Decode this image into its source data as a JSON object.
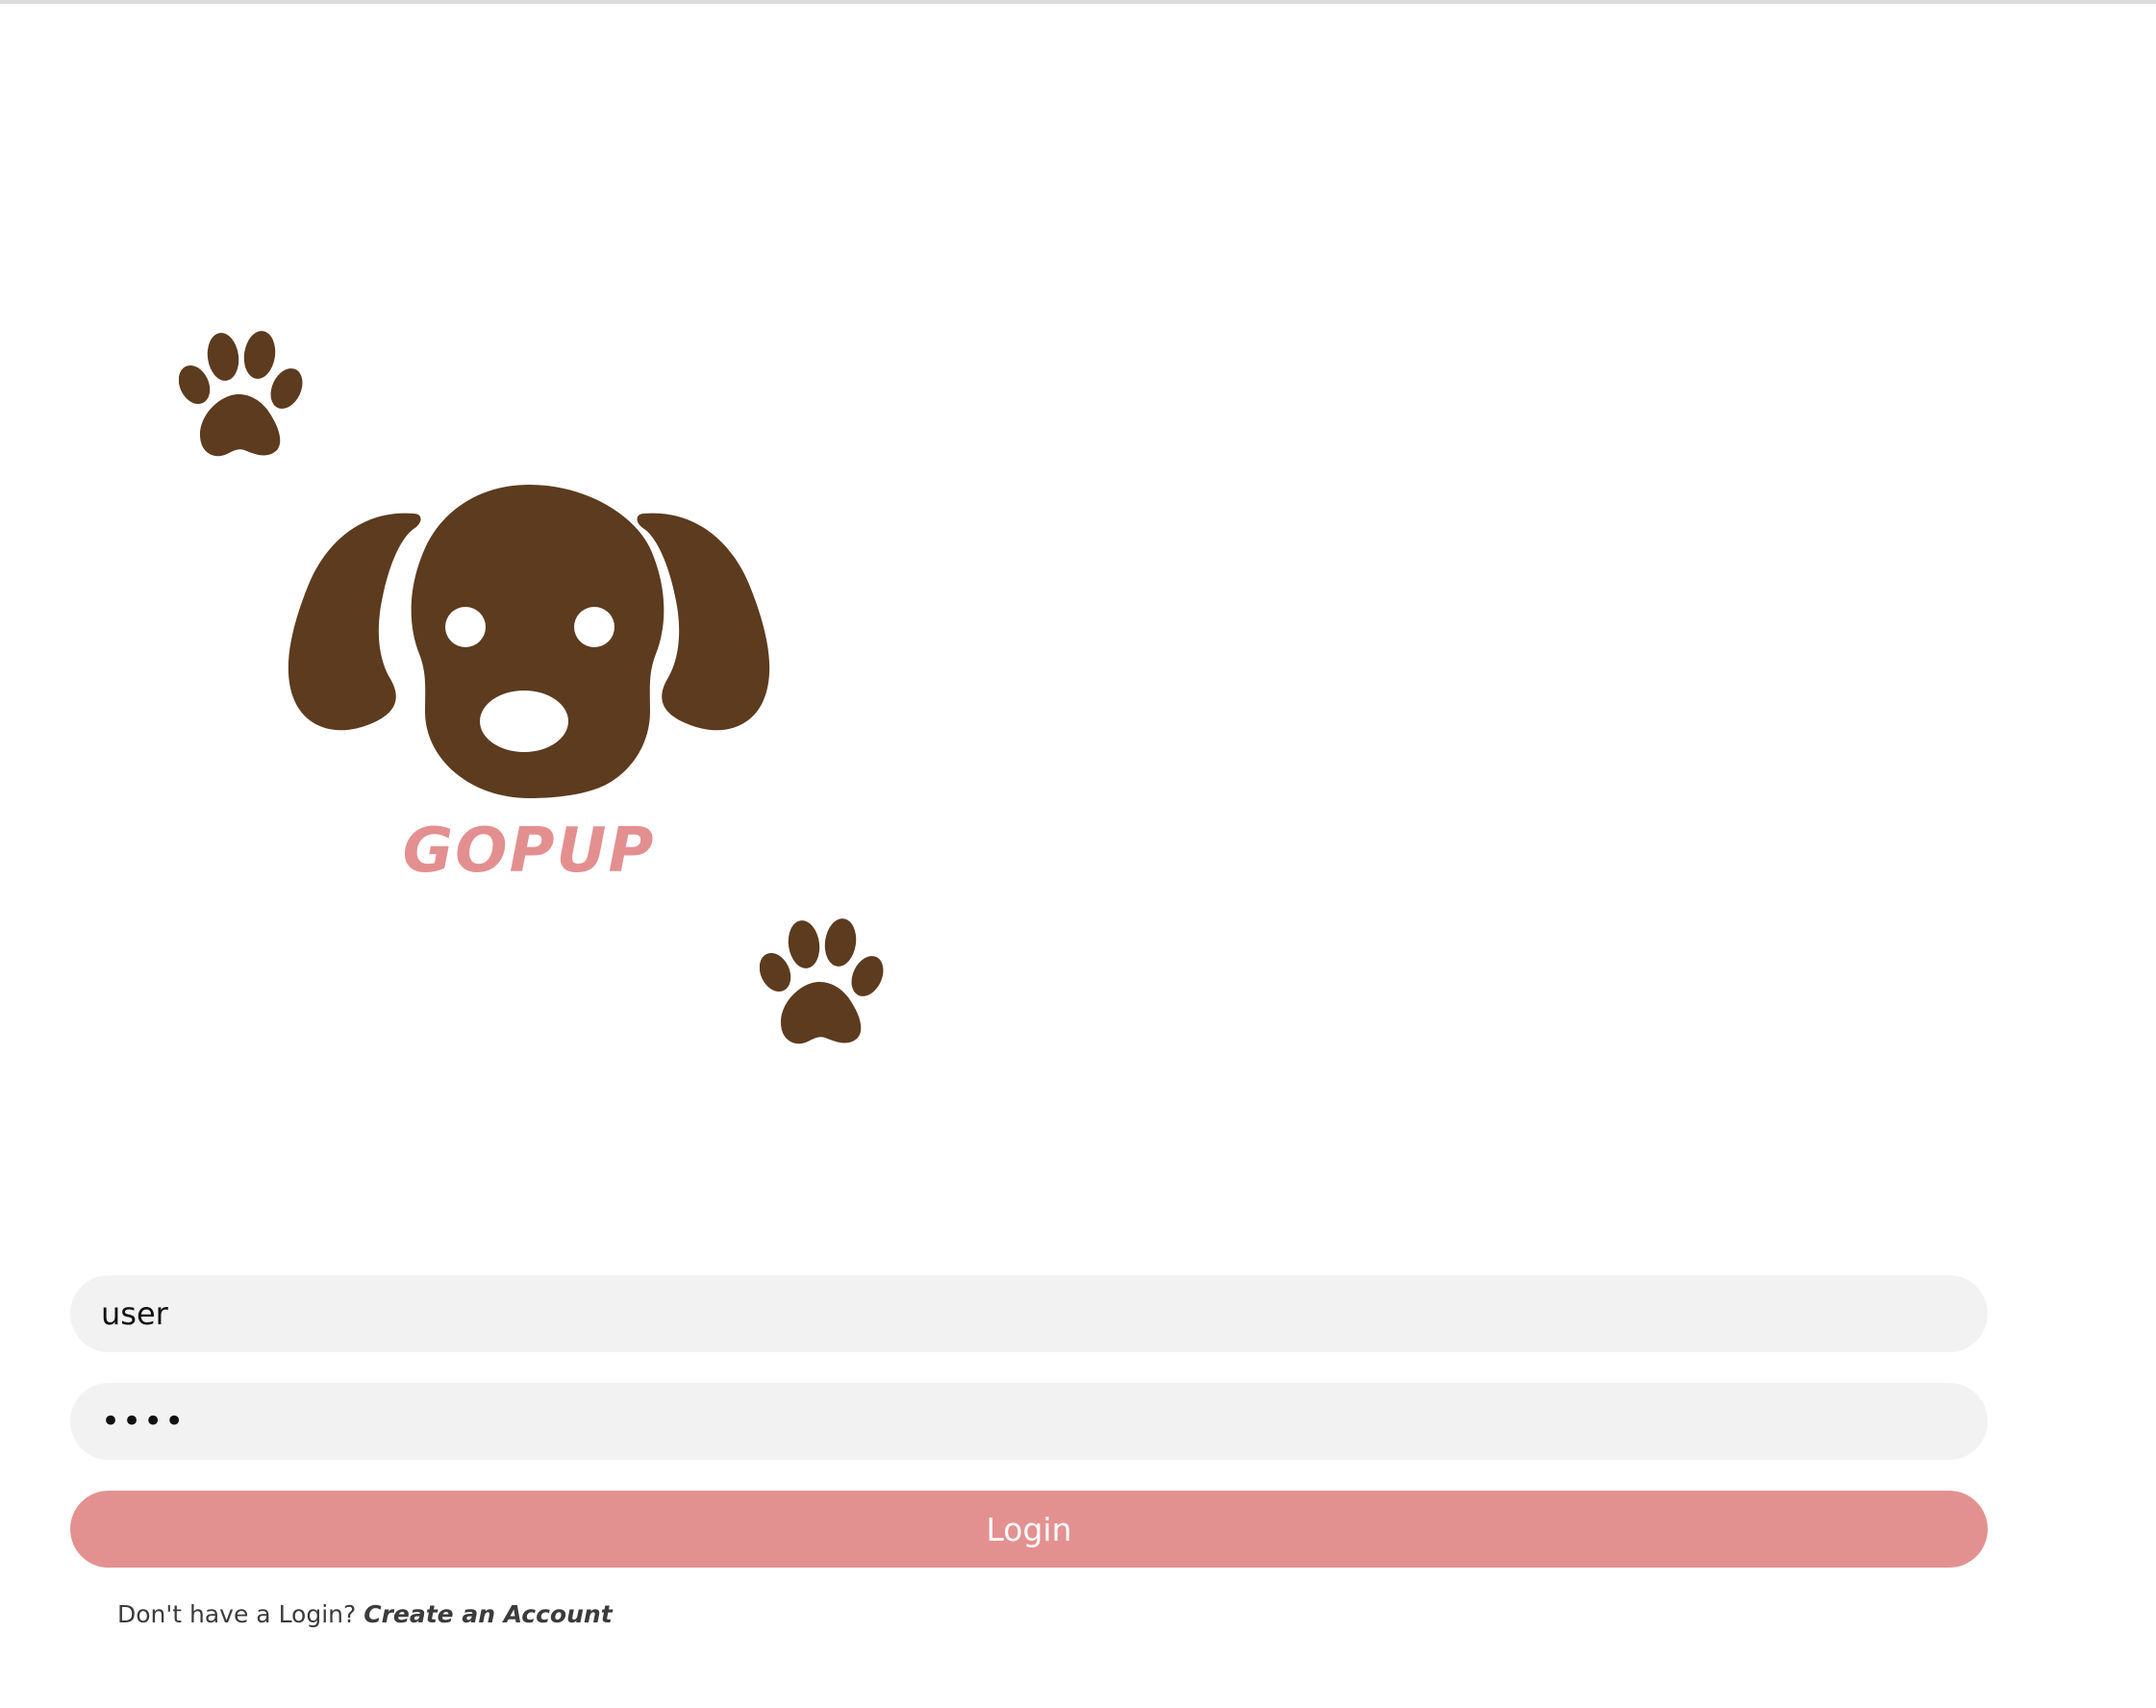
{
  "brand": {
    "name": "GOPUP",
    "color": "#e38f90",
    "logo_color": "#5c3b1e"
  },
  "login_form": {
    "username_value": "user",
    "password_value": "pass",
    "login_label": "Login",
    "accent_color": "#e39190",
    "signup_prompt": "Don't have a Login?",
    "signup_link": "Create an Account"
  },
  "icons": [
    "paw-print-icon",
    "dog-head-logo",
    "paw-print-icon"
  ]
}
